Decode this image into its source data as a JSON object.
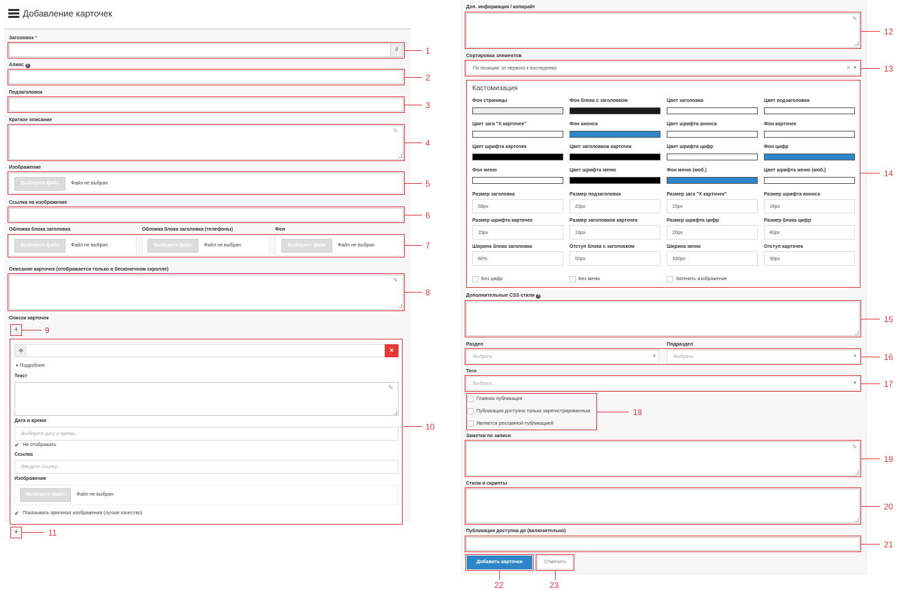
{
  "page": {
    "title": "Добавление карточек"
  },
  "left": {
    "title_label": "Заголовок",
    "title_required": "*",
    "title_counter": "0",
    "alias_label": "Алиас",
    "alias_help": "?",
    "subtitle_label": "Подзаголовок",
    "short_desc_label": "Краткое описание",
    "image_label": "Изображение",
    "choose_file": "Выберите файл",
    "no_file": "Файл не выбран",
    "image_link_label": "Ссылка на изображение",
    "cover_label": "Обложка блока заголовка",
    "cover_phone_label": "Обложка блока заголовка (телефоны)",
    "bg_label": "Фон",
    "cards_desc_label": "Описание карточек (отображается только в бесконечном скролле)",
    "cards_list_label": "Список карточек",
    "plus": "+",
    "card": {
      "more": "Подробнее",
      "text_label": "Текст",
      "datetime_label": "Дата и время",
      "datetime_placeholder": "Выберите дату и время...",
      "hide_label": "Не отображать",
      "link_label": "Ссылка",
      "link_placeholder": "Введите ссылку...",
      "image_label": "Изображение",
      "original_label": "Показывать оригинал изображения (лучше качество)",
      "delete": "×",
      "drag": "✥"
    }
  },
  "right": {
    "extra_info_label": "Доп. информация / копирайт",
    "sort_label": "Сортировка элементов",
    "sort_value": "По позиции: от первого к последнему",
    "sort_clear": "×",
    "custom_title": "Кастомизация",
    "color_fields": [
      {
        "label": "Фон страницы",
        "color": "#eeeeee"
      },
      {
        "label": "Фон блока с заголовком",
        "color": "#1a1a1a"
      },
      {
        "label": "Цвет заголовка",
        "color": "#ffffff"
      },
      {
        "label": "Цвет подзаголовка",
        "color": "#ffffff"
      },
      {
        "label": "Цвет зага \"X карточек\"",
        "color": "#ffffff"
      },
      {
        "label": "Фон анонса",
        "color": "#2e86c8"
      },
      {
        "label": "Цвет шрифта анонса",
        "color": "#ffffff"
      },
      {
        "label": "Фон карточек",
        "color": "#ffffff"
      },
      {
        "label": "Цвет шрифта карточек",
        "color": "#000000"
      },
      {
        "label": "Цвет заголовков карточек",
        "color": "#000000"
      },
      {
        "label": "Цвет шрифта цифр",
        "color": "#ffffff"
      },
      {
        "label": "Фон цифр",
        "color": "#2e86c8"
      },
      {
        "label": "Фон меню",
        "color": "#ffffff"
      },
      {
        "label": "Цвет шрифта меню",
        "color": "#000000"
      },
      {
        "label": "Фон меню (моб.)",
        "color": "#2e86c8"
      },
      {
        "label": "Цвет шрифта меню (моб.)",
        "color": "#ffffff"
      }
    ],
    "size_fields": [
      {
        "label": "Размер заголовка",
        "value": "58px"
      },
      {
        "label": "Размер подзаголовка",
        "value": "20px"
      },
      {
        "label": "Размер зага \"X карточек\"",
        "value": "15px"
      },
      {
        "label": "Размер шрифта анонса",
        "value": "16px"
      },
      {
        "label": "Размер шрифта карточек",
        "value": "15px"
      },
      {
        "label": "Размер заголовков карточек",
        "value": "18px"
      },
      {
        "label": "Размер шрифта цифр",
        "value": "20px"
      },
      {
        "label": "Размер блока цифр",
        "value": "40px"
      },
      {
        "label": "Ширина блока заголовка",
        "value": "60%"
      },
      {
        "label": "Отступ блока с заголовком",
        "value": "50px"
      },
      {
        "label": "Ширина меню",
        "value": "330px"
      },
      {
        "label": "Отступ карточек",
        "value": "30px"
      }
    ],
    "checks": [
      "Без цифр",
      "Без меню",
      "Затенить изображение"
    ],
    "css_label": "Дополнительные CSS стили",
    "css_help": "?",
    "section_label": "Раздел",
    "subsection_label": "Подраздел",
    "select_placeholder": "Выбрать",
    "tags_label": "Теги",
    "pub_checks": [
      "Главная публикация",
      "Публикация доступна только зарегистрированным",
      "Является рекламной публикацией"
    ],
    "notes_label": "Заметки по записи",
    "styles_label": "Стили и скрипты",
    "until_label": "Публикация доступна до (включительно)",
    "submit": "Добавить карточки",
    "cancel": "Отменить"
  },
  "callouts": [
    "1",
    "2",
    "3",
    "4",
    "5",
    "6",
    "7",
    "8",
    "9",
    "10",
    "11",
    "12",
    "13",
    "14",
    "15",
    "16",
    "17",
    "18",
    "19",
    "20",
    "21",
    "22",
    "23"
  ],
  "colors": {
    "annot": "#e2393f",
    "primary": "#2e86c8",
    "danger": "#e53935"
  }
}
